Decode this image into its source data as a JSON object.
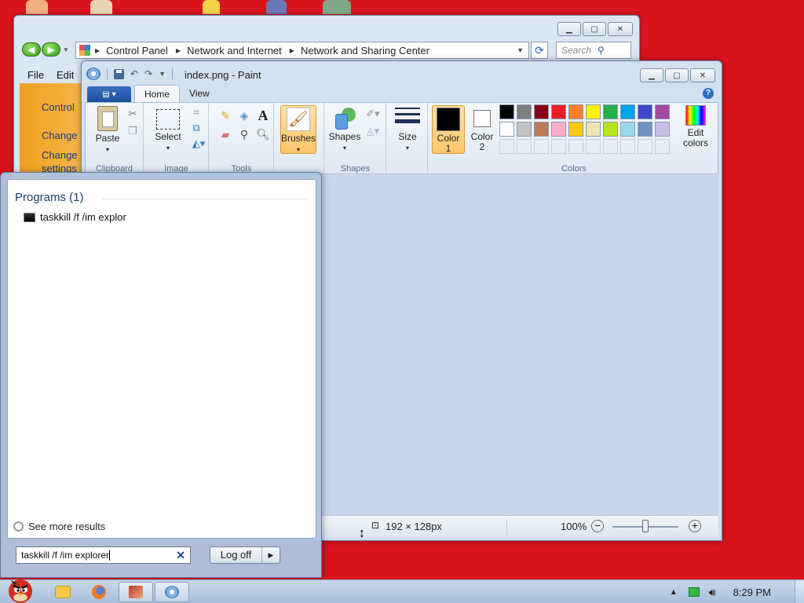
{
  "control_panel": {
    "breadcrumb": [
      "Control Panel",
      "Network and Internet",
      "Network and Sharing Center"
    ],
    "search_placeholder": "Search Co...",
    "menu": [
      "File",
      "Edit"
    ],
    "sidebar": [
      "Control",
      "Change",
      "Change",
      "settings"
    ]
  },
  "paint": {
    "title": "index.png - Paint",
    "tabs": [
      "Home",
      "View"
    ],
    "groups": {
      "clipboard": {
        "label": "Clipboard",
        "paste": "Paste"
      },
      "image": {
        "label": "Image",
        "select": "Select"
      },
      "tools": {
        "label": "Tools"
      },
      "brushes": "Brushes",
      "shapes": {
        "label": "Shapes",
        "shapes_btn": "Shapes"
      },
      "size": "Size",
      "colors": {
        "label": "Colors",
        "color1": "Color",
        "color1_num": "1",
        "color2": "Color",
        "color2_num": "2",
        "edit1": "Edit",
        "edit2": "colors"
      }
    },
    "palette_row1": [
      "#000000",
      "#7f7f7f",
      "#880015",
      "#ed1c24",
      "#ff7f27",
      "#fff200",
      "#22b14c",
      "#00a2e8",
      "#3f48cc",
      "#a349a4"
    ],
    "palette_row2": [
      "#ffffff",
      "#c3c3c3",
      "#b97a57",
      "#ffaec9",
      "#ffc90e",
      "#efe4b0",
      "#b5e61d",
      "#99d9ea",
      "#7092be",
      "#c8bfe7"
    ],
    "status": {
      "dimensions": "192 × 128px",
      "zoom": "100%"
    }
  },
  "start_menu": {
    "programs_header": "Programs (1)",
    "program_item": "taskkill /f /im explor",
    "see_more": "See more results",
    "search_value": "taskkill /f /im explorer",
    "log_off": "Log off"
  },
  "taskbar": {
    "time": "8:29 PM"
  }
}
